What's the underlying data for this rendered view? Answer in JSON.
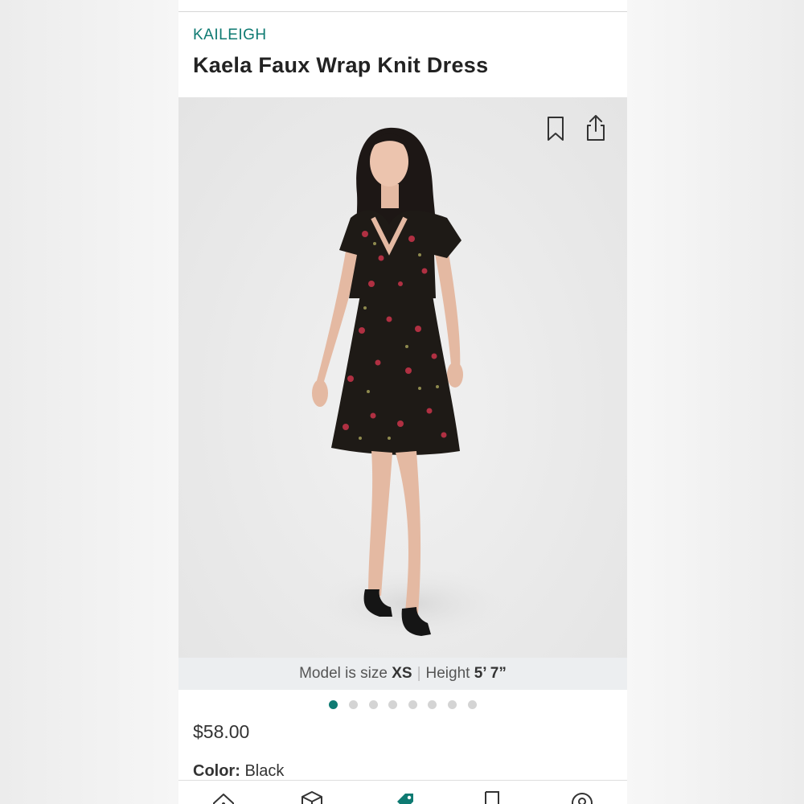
{
  "product": {
    "brand": "KAILEIGH",
    "title": "Kaela Faux Wrap Knit Dress",
    "price": "$58.00",
    "color_label": "Color:",
    "color_value": "Black"
  },
  "model_info": {
    "size_label": "Model is size",
    "size_value": "XS",
    "separator": "|",
    "height_label": "Height",
    "height_value": "5’ 7”"
  },
  "carousel": {
    "total": 8,
    "active_index": 0
  },
  "icons": {
    "bookmark": "bookmark-icon",
    "share": "share-icon",
    "tabs": [
      "home-icon",
      "box-icon",
      "tag-icon",
      "bookmark-icon",
      "profile-icon"
    ]
  },
  "colors": {
    "accent": "#0e7a72",
    "text": "#222222",
    "dot_inactive": "#d4d4d4"
  }
}
